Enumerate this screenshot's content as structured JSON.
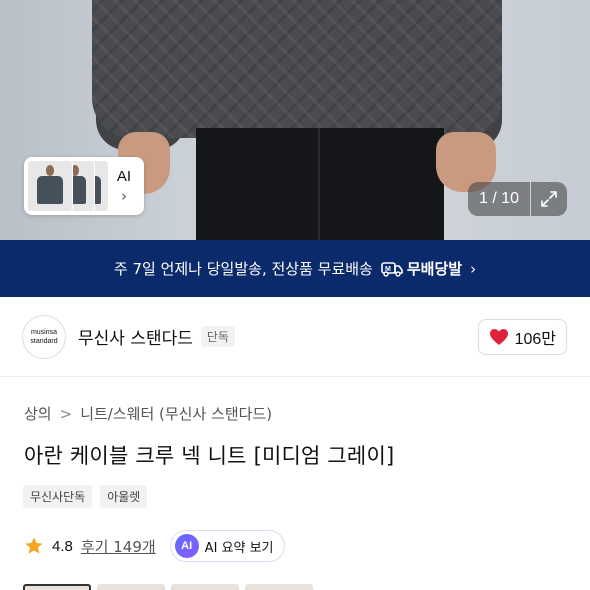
{
  "hero": {
    "thumbnail_ai_label": "AI",
    "thumbnail_chevron": "›",
    "counter": "1 / 10",
    "expand_icon": "expand-icon"
  },
  "banner": {
    "text": "주 7일 언제나 당일발송, 전상품 무료배송",
    "brand_label": "무배당발",
    "chevron": "›",
    "color": "#0b2a6b"
  },
  "brand": {
    "logo_line1": "musinsa",
    "logo_line2": "standard",
    "name": "무신사 스탠다드",
    "tag": "단독",
    "likes": "106만",
    "heart_color": "#e0213a"
  },
  "breadcrumb": {
    "items": [
      "상의",
      "니트/스웨터 (무신사 스탠다드)"
    ],
    "separator": ">"
  },
  "product": {
    "title": "아란 케이블 크루 넥 니트 [미디엄 그레이]",
    "tags": [
      "무신사단독",
      "아울렛"
    ]
  },
  "rating": {
    "score": "4.8",
    "reviews": "후기 149개",
    "ai_badge": "AI",
    "ai_summary_label": "AI 요약 보기",
    "star_color": "#f5a623"
  }
}
